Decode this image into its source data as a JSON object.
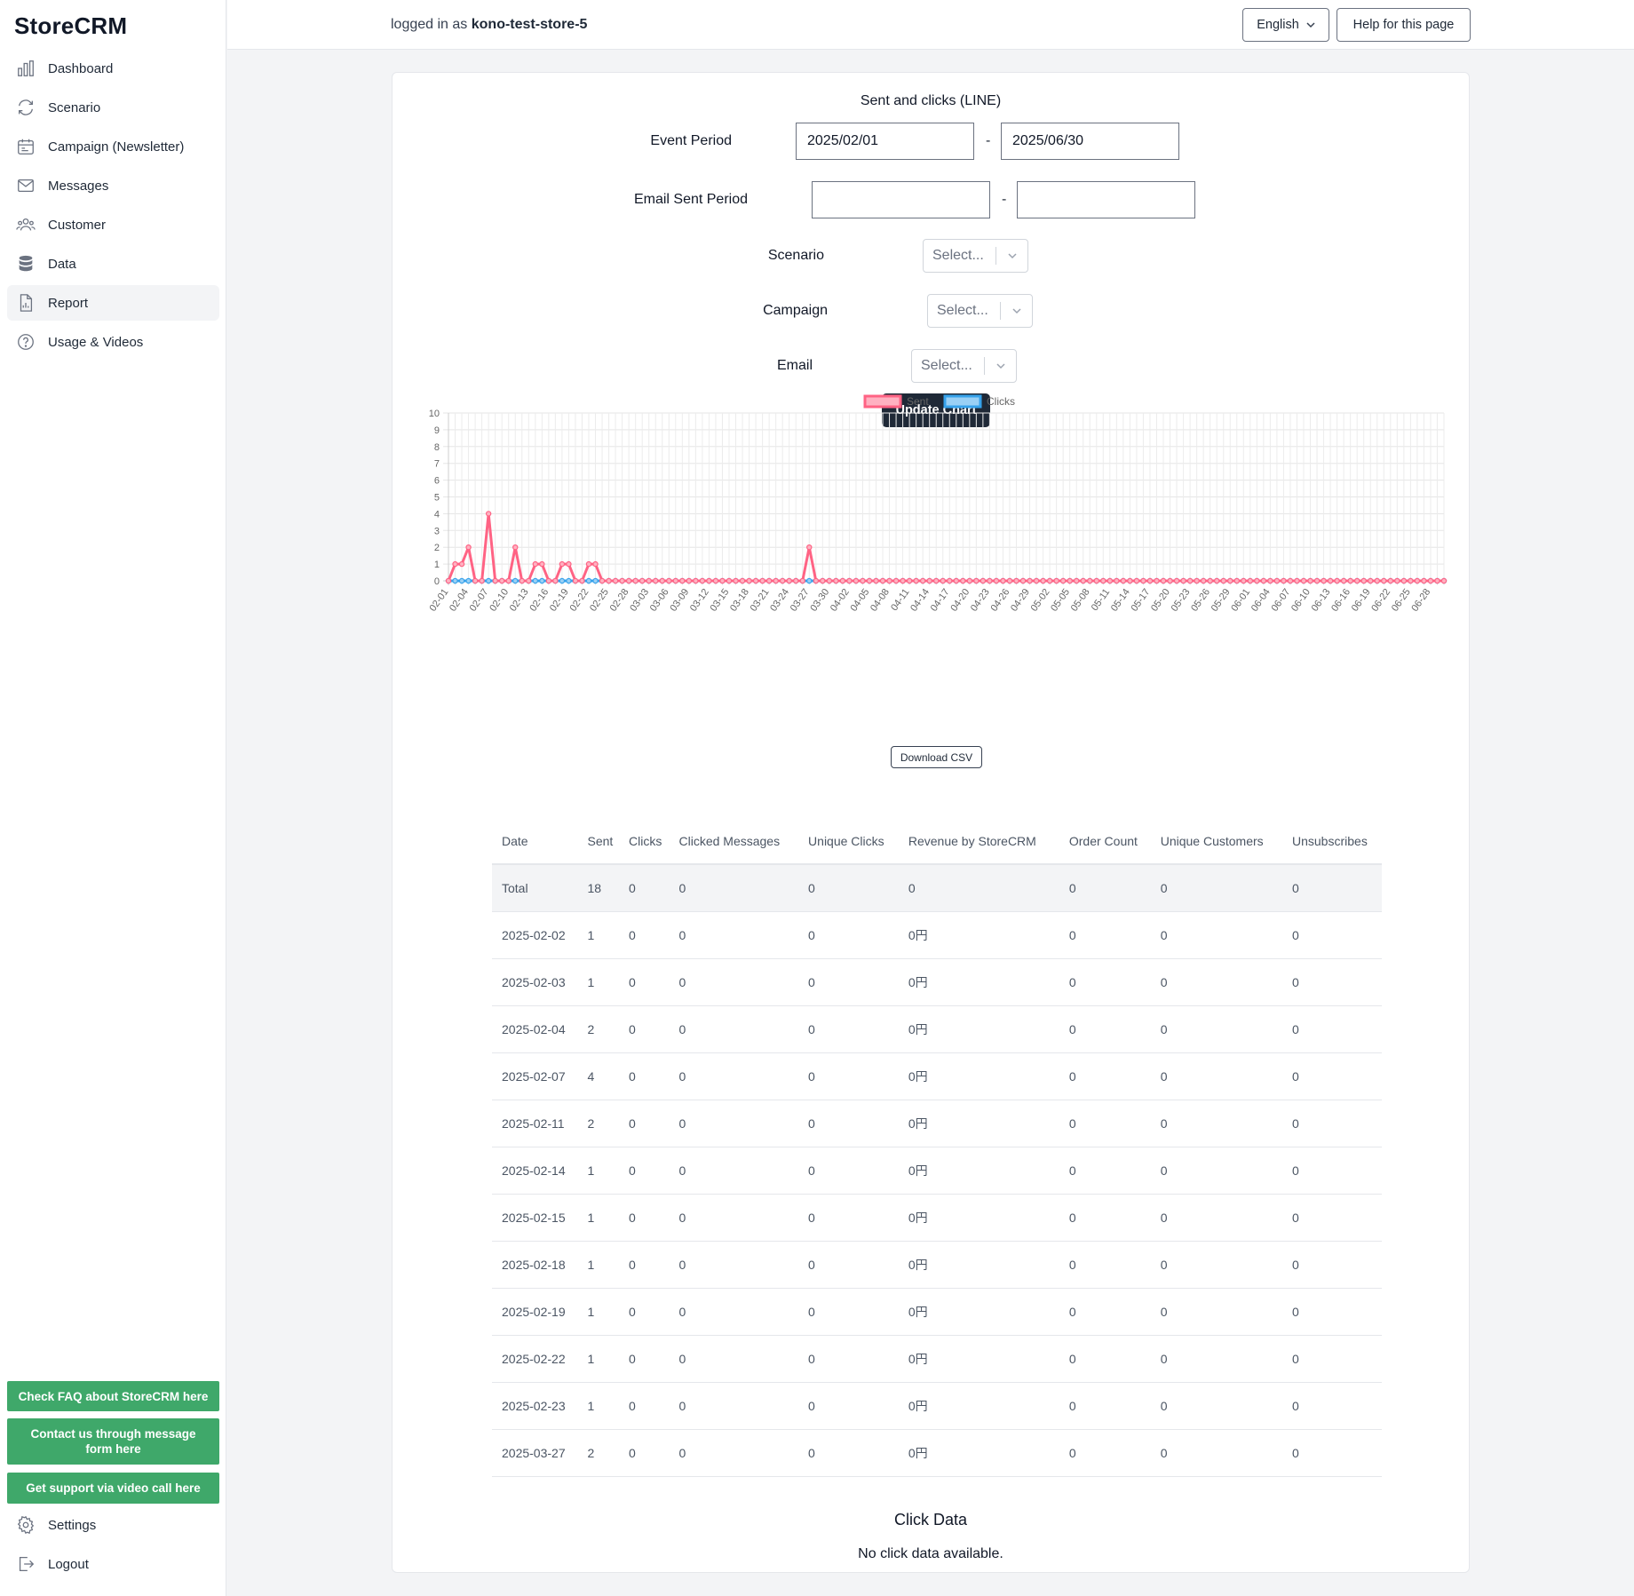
{
  "app": {
    "logo": "StoreCRM"
  },
  "sidebar": {
    "items": [
      {
        "label": "Dashboard",
        "icon": "bar-chart-icon"
      },
      {
        "label": "Scenario",
        "icon": "refresh-icon"
      },
      {
        "label": "Campaign (Newsletter)",
        "icon": "calendar-icon"
      },
      {
        "label": "Messages",
        "icon": "mail-icon"
      },
      {
        "label": "Customer",
        "icon": "users-icon"
      },
      {
        "label": "Data",
        "icon": "database-icon"
      },
      {
        "label": "Report",
        "icon": "document-chart-icon",
        "active": true
      },
      {
        "label": "Usage & Videos",
        "icon": "question-icon"
      }
    ],
    "support_buttons": [
      "Check FAQ about StoreCRM here",
      "Contact us through message form here",
      "Get support via video call here"
    ],
    "bottom_items": [
      {
        "label": "Settings",
        "icon": "gear-icon"
      },
      {
        "label": "Logout",
        "icon": "logout-icon"
      }
    ],
    "support_color": "#3fa86a"
  },
  "header": {
    "logged_prefix": "logged in as",
    "store_name": "kono-test-store-5",
    "language": "English",
    "help": "Help for this page"
  },
  "filters": {
    "title": "Sent and clicks (LINE)",
    "event_period_label": "Event Period",
    "event_start": "2025/02/01",
    "event_end": "2025/06/30",
    "email_sent_period_label": "Email Sent Period",
    "email_sent_start": "",
    "email_sent_end": "",
    "dash": "-",
    "scenario_label": "Scenario",
    "campaign_label": "Campaign",
    "email_label": "Email",
    "select_placeholder": "Select...",
    "update_button": "Update Chart"
  },
  "chart_data": {
    "type": "line",
    "ylim": [
      0,
      10
    ],
    "yticks": [
      0,
      1,
      2,
      3,
      4,
      5,
      6,
      7,
      8,
      9,
      10
    ],
    "grid": true,
    "legend_position": "top-center",
    "x_start": "2025-02-01",
    "x_end": "2025-06-30",
    "tick_every_days": 3,
    "series": [
      {
        "name": "Sent",
        "color": "#ff6384",
        "fill": "#ffb1c1",
        "values_by_date": {
          "02-02": 1,
          "02-03": 1,
          "02-04": 2,
          "02-07": 4,
          "02-11": 2,
          "02-14": 1,
          "02-15": 1,
          "02-18": 1,
          "02-19": 1,
          "02-22": 1,
          "02-23": 1,
          "03-27": 2
        },
        "default_value": 0
      },
      {
        "name": "Clicks",
        "color": "#36a2eb",
        "fill": "#9ad0f5",
        "values_by_date": {},
        "default_value": 0
      }
    ]
  },
  "csv_button": "Download CSV",
  "table": {
    "headers": [
      "Date",
      "Sent",
      "Clicks",
      "Clicked Messages",
      "Unique Clicks",
      "Revenue by StoreCRM",
      "Order Count",
      "Unique Customers",
      "Unsubscribes"
    ],
    "total": [
      "Total",
      "18",
      "0",
      "0",
      "0",
      "0",
      "0",
      "0",
      "0"
    ],
    "rows": [
      [
        "2025-02-02",
        "1",
        "0",
        "0",
        "0",
        "0円",
        "0",
        "0",
        "0"
      ],
      [
        "2025-02-03",
        "1",
        "0",
        "0",
        "0",
        "0円",
        "0",
        "0",
        "0"
      ],
      [
        "2025-02-04",
        "2",
        "0",
        "0",
        "0",
        "0円",
        "0",
        "0",
        "0"
      ],
      [
        "2025-02-07",
        "4",
        "0",
        "0",
        "0",
        "0円",
        "0",
        "0",
        "0"
      ],
      [
        "2025-02-11",
        "2",
        "0",
        "0",
        "0",
        "0円",
        "0",
        "0",
        "0"
      ],
      [
        "2025-02-14",
        "1",
        "0",
        "0",
        "0",
        "0円",
        "0",
        "0",
        "0"
      ],
      [
        "2025-02-15",
        "1",
        "0",
        "0",
        "0",
        "0円",
        "0",
        "0",
        "0"
      ],
      [
        "2025-02-18",
        "1",
        "0",
        "0",
        "0",
        "0円",
        "0",
        "0",
        "0"
      ],
      [
        "2025-02-19",
        "1",
        "0",
        "0",
        "0",
        "0円",
        "0",
        "0",
        "0"
      ],
      [
        "2025-02-22",
        "1",
        "0",
        "0",
        "0",
        "0円",
        "0",
        "0",
        "0"
      ],
      [
        "2025-02-23",
        "1",
        "0",
        "0",
        "0",
        "0円",
        "0",
        "0",
        "0"
      ],
      [
        "2025-03-27",
        "2",
        "0",
        "0",
        "0",
        "0円",
        "0",
        "0",
        "0"
      ]
    ]
  },
  "click_data": {
    "title": "Click Data",
    "empty": "No click data available."
  }
}
